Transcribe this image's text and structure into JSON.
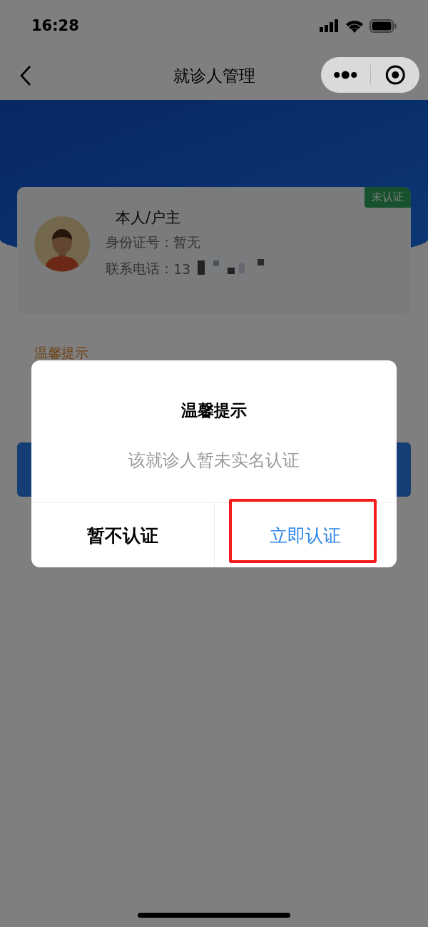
{
  "status_bar": {
    "time": "16:28"
  },
  "nav": {
    "title": "就诊人管理"
  },
  "patient_card": {
    "name": "本人/户主",
    "id_label": "身份证号：",
    "id_value": "暂无",
    "phone_label": "联系电话：",
    "phone_value": "13",
    "verified": false,
    "badge": "未认证"
  },
  "notice": {
    "title": "温馨提示"
  },
  "dialog": {
    "title": "温馨提示",
    "message": "该就诊人暂未实名认证",
    "buttons": [
      {
        "label": "暂不认证",
        "kind": "cancel",
        "highlighted": false
      },
      {
        "label": "立即认证",
        "kind": "confirm",
        "highlighted": true
      }
    ]
  }
}
